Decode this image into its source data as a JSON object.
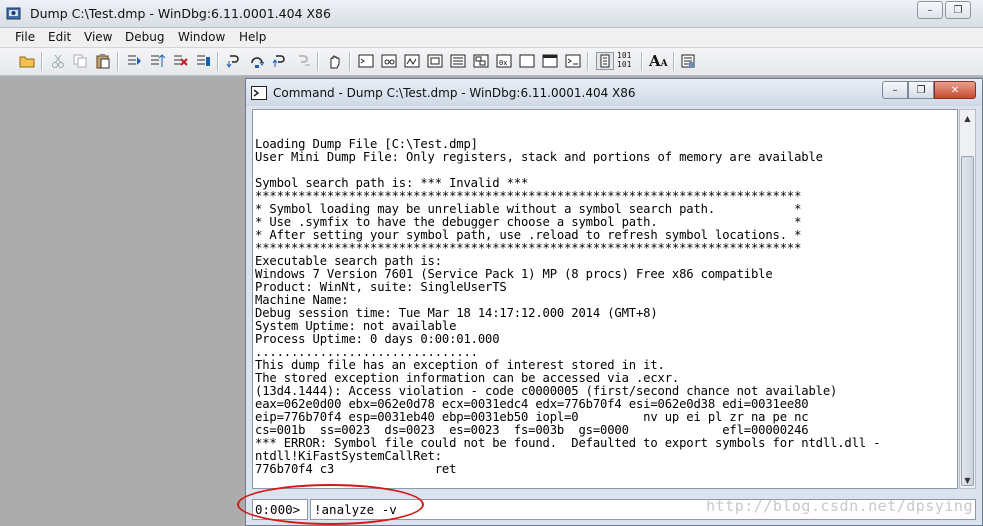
{
  "main_window": {
    "title": "Dump C:\\Test.dmp - WinDbg:6.11.0001.404 X86",
    "controls": {
      "minimize": "–",
      "restore": "❐"
    }
  },
  "menu": [
    "File",
    "Edit",
    "View",
    "Debug",
    "Window",
    "Help"
  ],
  "toolbar": {
    "icons": [
      "open-icon",
      "cut-icon",
      "copy-icon",
      "paste-icon",
      "go-icon",
      "restart-icon",
      "stop-debugging-icon",
      "detach-icon",
      "step-into-icon",
      "step-over-icon",
      "step-out-icon",
      "run-to-cursor-icon",
      "breakpoint-hand-icon",
      "command-window-icon",
      "watch-icon",
      "locals-icon",
      "registers-icon",
      "memory-icon",
      "call-stack-icon",
      "disassembly-icon",
      "scratch-pad-icon",
      "processes-icon",
      "source-mode-icon",
      "hex-mode-icon",
      "font-icon",
      "options-icon"
    ],
    "font_button_label": "A",
    "hex_label_top": "101",
    "hex_label_bottom": "101"
  },
  "command_window": {
    "title": "Command - Dump C:\\Test.dmp - WinDbg:6.11.0001.404 X86",
    "controls": {
      "minimize": "–",
      "restore": "❐",
      "close": "✕"
    },
    "output_lines": [
      "Loading Dump File [C:\\Test.dmp]",
      "User Mini Dump File: Only registers, stack and portions of memory are available",
      "",
      "Symbol search path is: *** Invalid ***",
      "****************************************************************************",
      "* Symbol loading may be unreliable without a symbol search path.           *",
      "* Use .symfix to have the debugger choose a symbol path.                   *",
      "* After setting your symbol path, use .reload to refresh symbol locations. *",
      "****************************************************************************",
      "Executable search path is:",
      "Windows 7 Version 7601 (Service Pack 1) MP (8 procs) Free x86 compatible",
      "Product: WinNt, suite: SingleUserTS",
      "Machine Name:",
      "Debug session time: Tue Mar 18 14:17:12.000 2014 (GMT+8)",
      "System Uptime: not available",
      "Process Uptime: 0 days 0:00:01.000",
      "...............................",
      "This dump file has an exception of interest stored in it.",
      "The stored exception information can be accessed via .ecxr.",
      "(13d4.1444): Access violation - code c0000005 (first/second chance not available)",
      "eax=062e0d00 ebx=062e0d78 ecx=0031edc4 edx=776b70f4 esi=062e0d38 edi=0031ee80",
      "eip=776b70f4 esp=0031eb40 ebp=0031eb50 iopl=0         nv up ei pl zr na pe nc",
      "cs=001b  ss=0023  ds=0023  es=0023  fs=003b  gs=0000             efl=00000246",
      "*** ERROR: Symbol file could not be found.  Defaulted to export symbols for ntdll.dll -",
      "ntdll!KiFastSystemCallRet:",
      "776b70f4 c3              ret"
    ],
    "prompt": "0:000>",
    "input_value": "!analyze -v"
  },
  "watermark": "http://blog.csdn.net/dpsying",
  "colors": {
    "highlight_ellipse": "#d41818"
  }
}
